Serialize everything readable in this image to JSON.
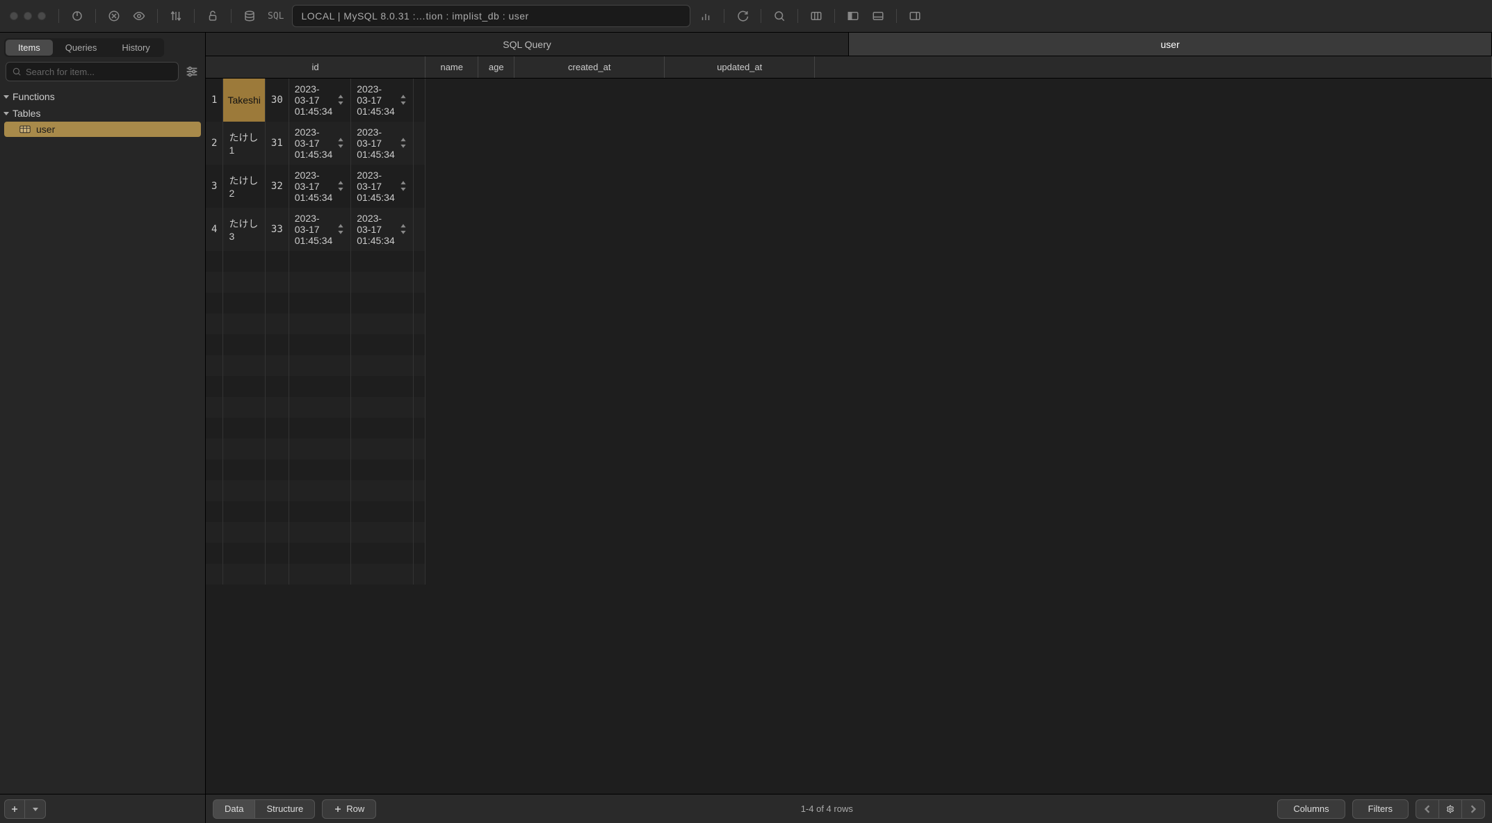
{
  "toolbar": {
    "location": "LOCAL | MySQL 8.0.31 :…tion : implist_db : user"
  },
  "sidebar": {
    "tabs": {
      "items": "Items",
      "queries": "Queries",
      "history": "History"
    },
    "search_placeholder": "Search for item...",
    "groups": {
      "functions": "Functions",
      "tables": "Tables"
    },
    "tables": [
      {
        "name": "user"
      }
    ]
  },
  "content_tabs": {
    "sql_query": "SQL Query",
    "table_name": "user"
  },
  "columns": [
    "id",
    "name",
    "age",
    "created_at",
    "updated_at"
  ],
  "rows": [
    {
      "id": "1",
      "name": "Takeshi",
      "age": "30",
      "created_at": "2023-03-17 01:45:34",
      "updated_at": "2023-03-17 01:45:34",
      "editing": true
    },
    {
      "id": "2",
      "name": "たけし1",
      "age": "31",
      "created_at": "2023-03-17 01:45:34",
      "updated_at": "2023-03-17 01:45:34"
    },
    {
      "id": "3",
      "name": "たけし2",
      "age": "32",
      "created_at": "2023-03-17 01:45:34",
      "updated_at": "2023-03-17 01:45:34"
    },
    {
      "id": "4",
      "name": "たけし3",
      "age": "33",
      "created_at": "2023-03-17 01:45:34",
      "updated_at": "2023-03-17 01:45:34"
    }
  ],
  "footer": {
    "data": "Data",
    "structure": "Structure",
    "row": "Row",
    "info": "1-4 of 4 rows",
    "columns": "Columns",
    "filters": "Filters"
  }
}
